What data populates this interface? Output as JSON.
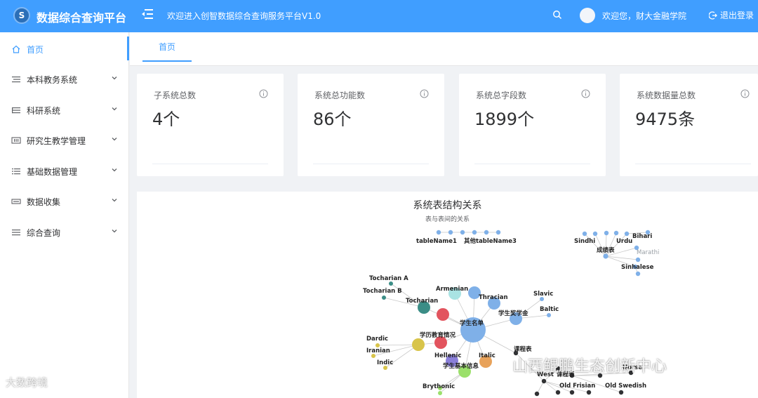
{
  "header": {
    "logo_letter": "S",
    "app_title": "数据综合查询平台",
    "welcome": "欢迎进入创智数据综合查询服务平台V1.0",
    "user_greet": "欢迎您，财大金融学院",
    "logout": "退出登录"
  },
  "sidebar": {
    "items": [
      {
        "label": "首页",
        "icon": "home-icon"
      },
      {
        "label": "本科教务系统",
        "icon": "list-icon"
      },
      {
        "label": "科研系统",
        "icon": "list-icon"
      },
      {
        "label": "研究生教学管理",
        "icon": "barcode-icon"
      },
      {
        "label": "基础数据管理",
        "icon": "list-icon"
      },
      {
        "label": "数据收集",
        "icon": "box-icon"
      },
      {
        "label": "综合查询",
        "icon": "list-icon"
      }
    ]
  },
  "tabs": [
    {
      "label": "首页"
    }
  ],
  "cards": [
    {
      "label": "子系统总数",
      "value": "4个"
    },
    {
      "label": "系统总功能数",
      "value": "86个"
    },
    {
      "label": "系统总字段数",
      "value": "1899个"
    },
    {
      "label": "系统数据量总数",
      "value": "9475条"
    }
  ],
  "graph": {
    "title": "系统表结构关系",
    "subtitle": "表与表间的关系",
    "labels": [
      "tableName1",
      "其他tableName3",
      "Sindhi",
      "Urdu",
      "Bihari",
      "成绩表",
      "Marathi",
      "Sinhalese",
      "Tocharian A",
      "Tocharian B",
      "Tocharian",
      "Armenian",
      "Thracian",
      "Slavic",
      "Baltic",
      "学生奖学金",
      "学生名单",
      "Dardic",
      "学历教育情况",
      "Iranian",
      "Indic",
      "Hellenic",
      "Italic",
      "课程表",
      "学生基本信息",
      "Brythonic",
      "West",
      "课程表",
      "Norse",
      "Old Frisian",
      "Old Swedish"
    ]
  },
  "watermarks": {
    "left": "大数跨境",
    "right": "山西鲲鹏生态创新中心"
  }
}
